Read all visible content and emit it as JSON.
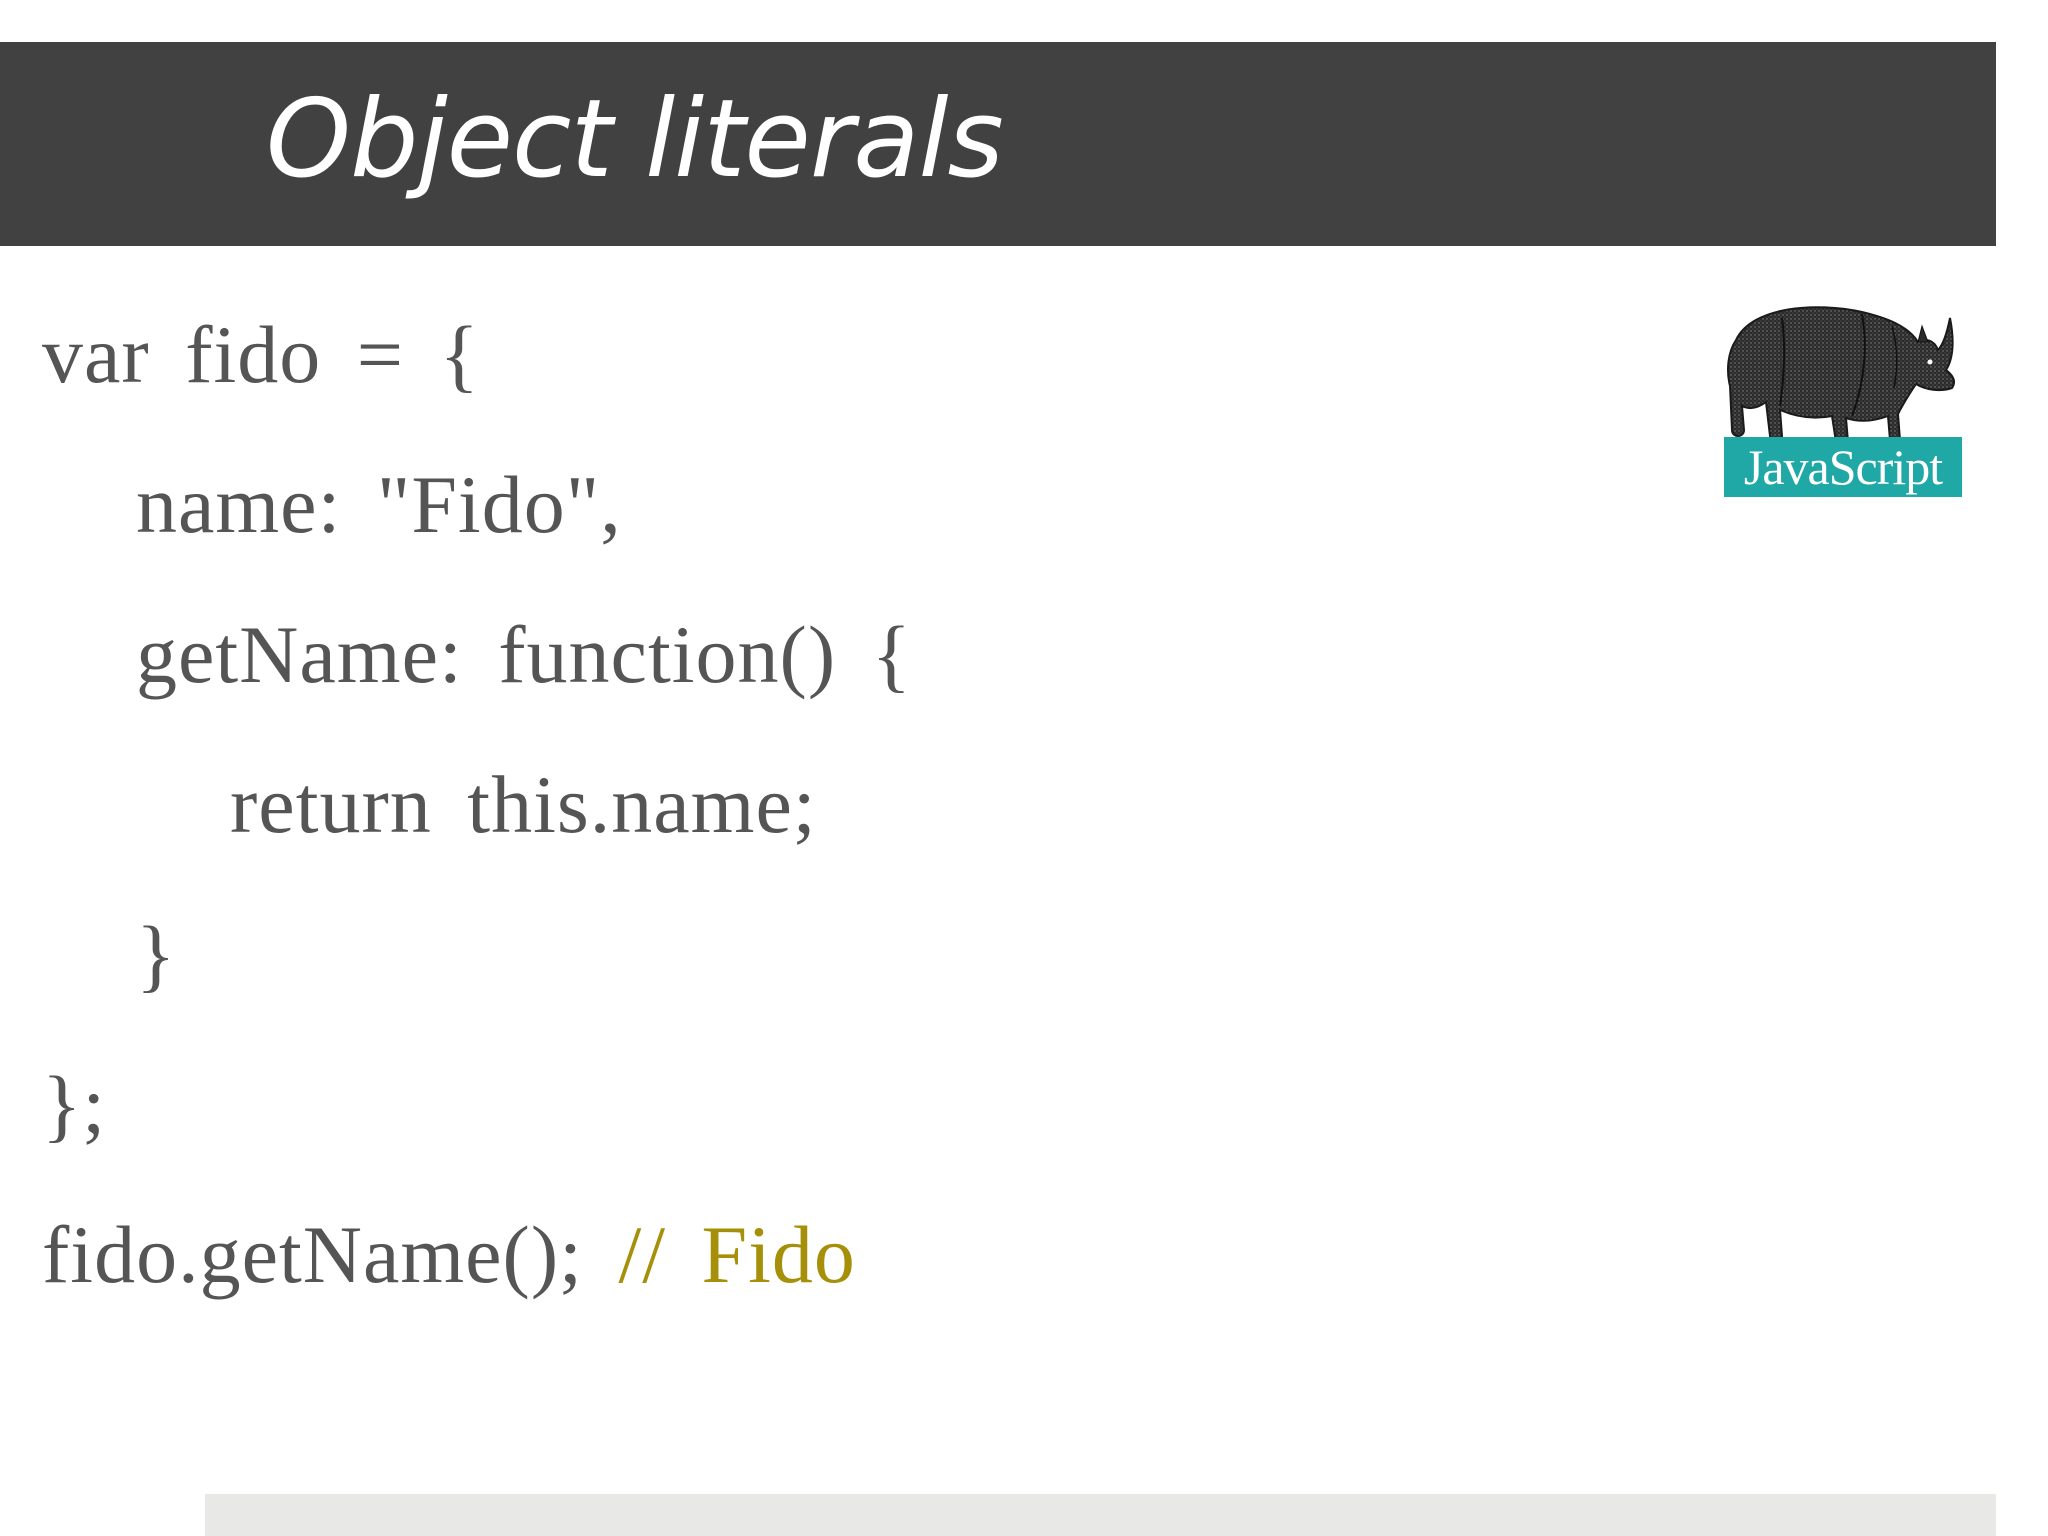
{
  "slide": {
    "title": "Object literals",
    "code_lines": [
      "var fido = {",
      "name: \"Fido\",",
      "getName: function() {",
      "return this.name;",
      "}",
      "};",
      "fido.getName();"
    ],
    "comment": "// Fido",
    "logo": {
      "label": "JavaScript",
      "icon": "rhino-icon",
      "label_color": "#1fa8a6"
    },
    "colors": {
      "title_bar": "#414141",
      "code_text": "#555555",
      "comment": "#a6900a"
    }
  }
}
